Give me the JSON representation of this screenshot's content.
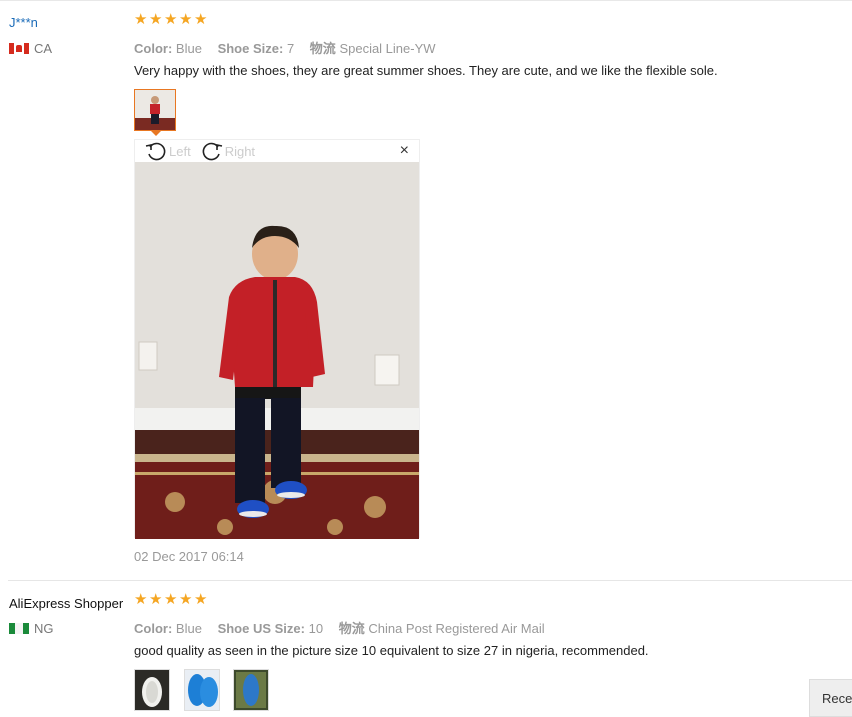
{
  "reviews": [
    {
      "user": "J***n",
      "country": "CA",
      "rating": 5,
      "attributes": [
        {
          "key": "Color:",
          "value": "Blue"
        },
        {
          "key": "Shoe Size:",
          "value": "7"
        },
        {
          "key": "物流",
          "value": "Special Line-YW"
        }
      ],
      "text": "Very happy with the shoes, they are great summer shoes. They are cute, and we like the flexible sole.",
      "viewer": {
        "rotate_left": "Left",
        "rotate_right": "Right",
        "close": "×"
      },
      "date": "02 Dec 2017 06:14"
    },
    {
      "user": "AliExpress Shopper",
      "country": "NG",
      "rating": 5,
      "attributes": [
        {
          "key": "Color:",
          "value": "Blue"
        },
        {
          "key": "Shoe US Size:",
          "value": "10"
        },
        {
          "key": "物流",
          "value": "China Post Registered Air Mail"
        }
      ],
      "text": "good quality as seen in the picture size 10 equivalent to size 27 in nigeria, recommended."
    }
  ],
  "recent_button": "Rece",
  "colors": {
    "star": "#f5a623",
    "link": "#1a6bb8",
    "active_thumb": "#e87722"
  }
}
